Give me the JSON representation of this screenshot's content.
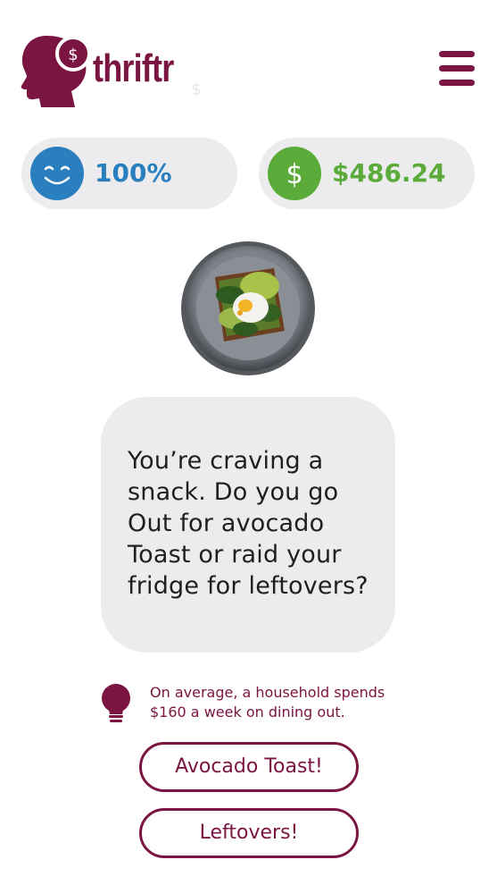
{
  "header": {
    "logo_text": "thriftr",
    "logo_badge": "$",
    "faint_symbol": "$",
    "menu_icon": "hamburger-menu-icon"
  },
  "stats": {
    "happiness": {
      "icon": "smiley-face-icon",
      "value": "100%",
      "color": "#2a7fbf"
    },
    "money": {
      "icon": "dollar-icon",
      "icon_glyph": "$",
      "value": "$486.24",
      "color": "#5aab3a"
    }
  },
  "scenario": {
    "image_icon": "avocado-toast-photo",
    "question": "You’re craving a snack. Do you go Out for avocado Toast or raid your fridge for leftovers?"
  },
  "tip": {
    "icon": "lightbulb-icon",
    "text": "On average, a household spends $160 a week on dining out."
  },
  "choices": [
    {
      "label": "Avocado Toast!"
    },
    {
      "label": "Leftovers!"
    }
  ],
  "colors": {
    "brand": "#7a1440",
    "card_background": "#ececee",
    "happiness": "#2a7fbf",
    "money": "#5aab3a"
  }
}
